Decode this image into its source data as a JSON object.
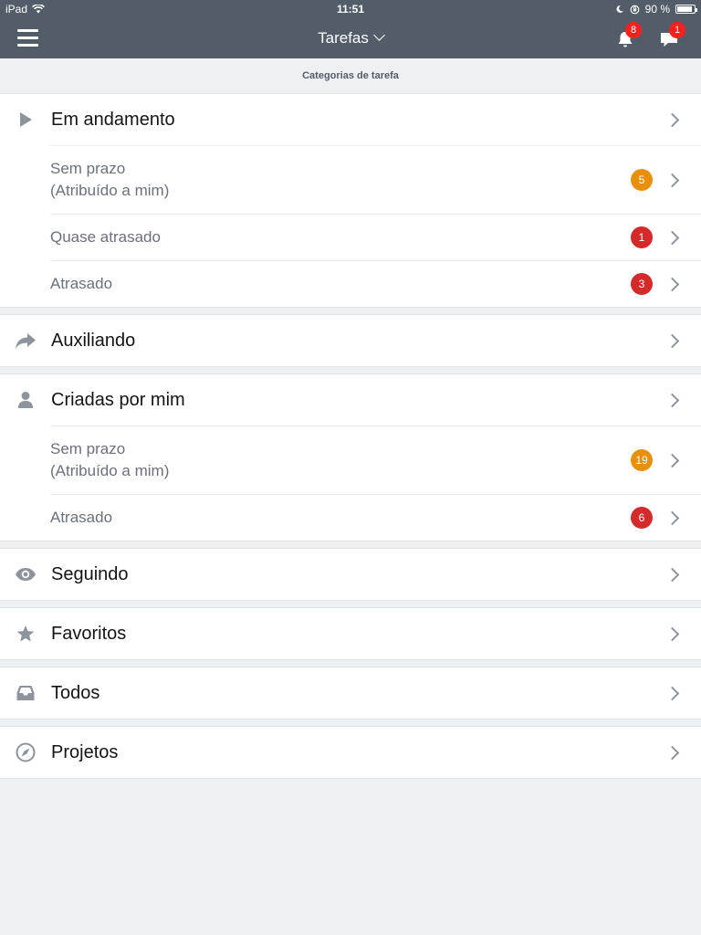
{
  "status": {
    "device": "iPad",
    "time": "11:51",
    "battery": "90 %",
    "battery_level": 0.9
  },
  "nav": {
    "title": "Tarefas",
    "notifications_count": "8",
    "messages_count": "1"
  },
  "section_title": "Categorias de tarefa",
  "colors": {
    "header_bg": "#535c69",
    "badge_orange": "#e8900c",
    "badge_red": "#d52a2a",
    "nav_badge": "#ff1f1f"
  },
  "categories": {
    "in_progress": {
      "label": "Em andamento",
      "icon": "play-icon",
      "items": [
        {
          "label_line1": "Sem prazo",
          "label_line2": "(Atribuído a mim)",
          "count": "5"
        },
        {
          "label": "Quase atrasado",
          "count": "1"
        },
        {
          "label": "Atrasado",
          "count": "3"
        }
      ]
    },
    "assisting": {
      "label": "Auxiliando",
      "icon": "forward-arrow-icon"
    },
    "created_by_me": {
      "label": "Criadas por mim",
      "icon": "person-icon",
      "items": [
        {
          "label_line1": "Sem prazo",
          "label_line2": "(Atribuído a mim)",
          "count": "19"
        },
        {
          "label": "Atrasado",
          "count": "6"
        }
      ]
    },
    "following": {
      "label": "Seguindo",
      "icon": "eye-icon"
    },
    "favorites": {
      "label": "Favoritos",
      "icon": "star-icon"
    },
    "all": {
      "label": "Todos",
      "icon": "inbox-icon"
    },
    "projects": {
      "label": "Projetos",
      "icon": "compass-icon"
    }
  }
}
